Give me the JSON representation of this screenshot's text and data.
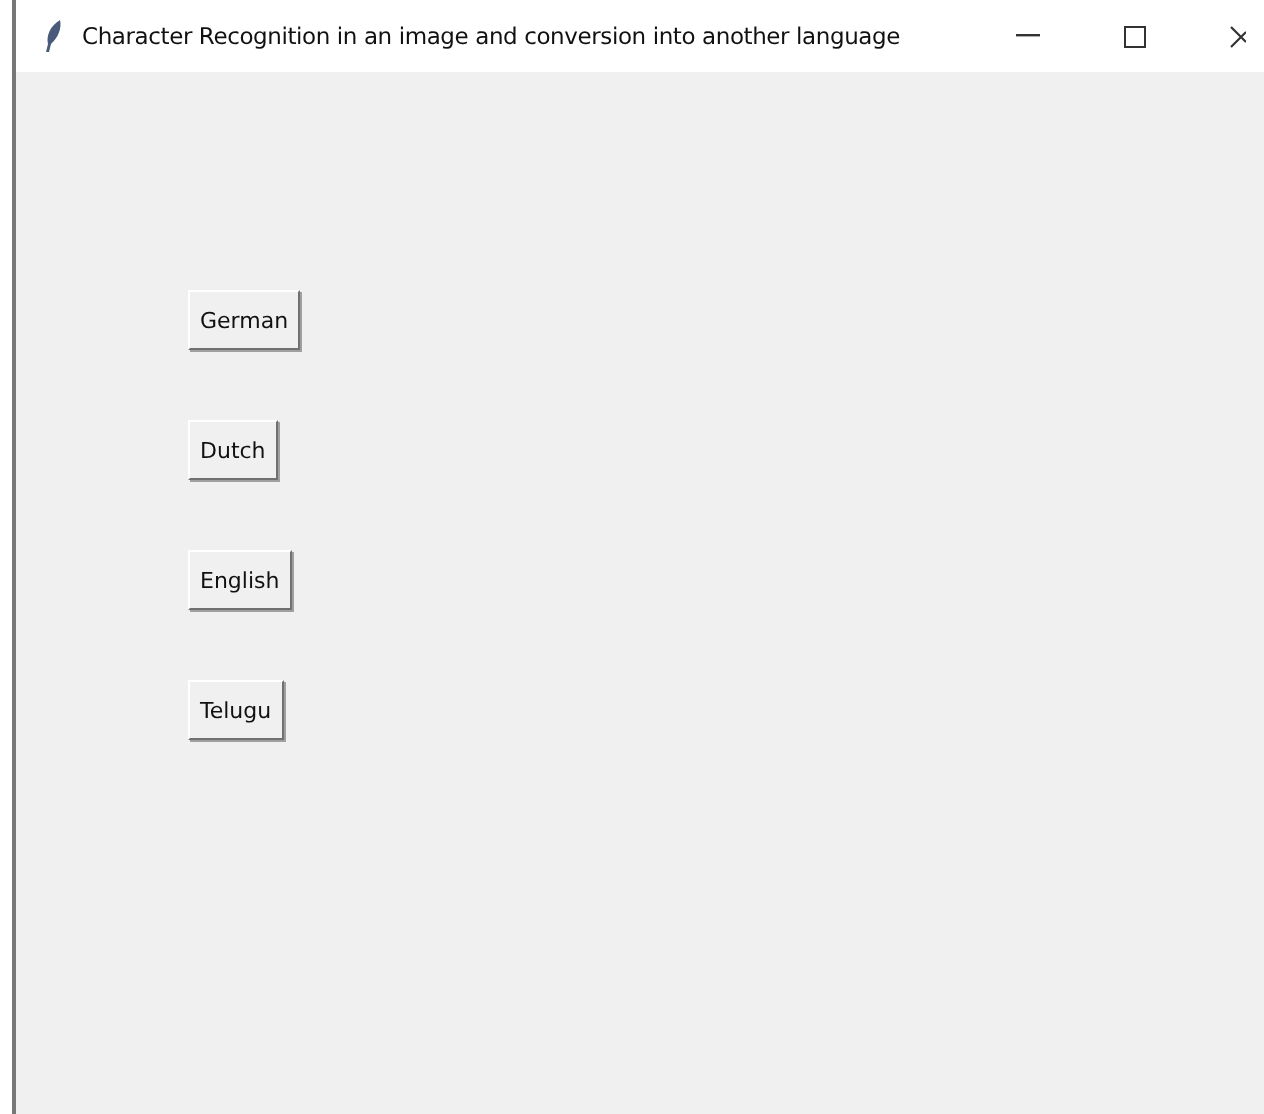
{
  "window": {
    "title": "Character Recognition in an image and conversion into another language"
  },
  "buttons": [
    {
      "label": "German"
    },
    {
      "label": "Dutch"
    },
    {
      "label": "English"
    },
    {
      "label": "Telugu"
    }
  ]
}
